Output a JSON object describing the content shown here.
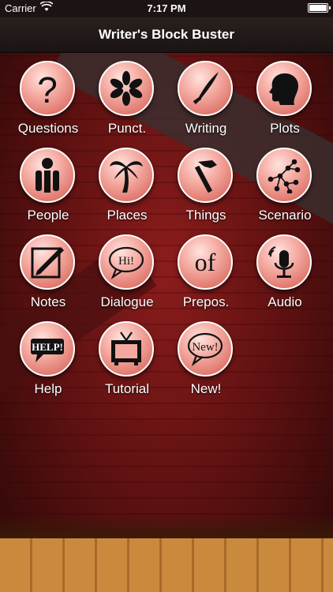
{
  "status_bar": {
    "carrier": "Carrier",
    "time": "7:17 PM"
  },
  "navbar": {
    "title": "Writer's Block Buster"
  },
  "tiles": [
    {
      "label": "Questions"
    },
    {
      "label": "Punct."
    },
    {
      "label": "Writing"
    },
    {
      "label": "Plots"
    },
    {
      "label": "People"
    },
    {
      "label": "Places"
    },
    {
      "label": "Things"
    },
    {
      "label": "Scenario"
    },
    {
      "label": "Notes"
    },
    {
      "label": "Dialogue",
      "icon_text": "Hi!"
    },
    {
      "label": "Prepos.",
      "icon_text": "of"
    },
    {
      "label": "Audio"
    },
    {
      "label": "Help",
      "icon_text": "HELP!"
    },
    {
      "label": "Tutorial"
    },
    {
      "label": "New!",
      "icon_text": "New!"
    }
  ]
}
